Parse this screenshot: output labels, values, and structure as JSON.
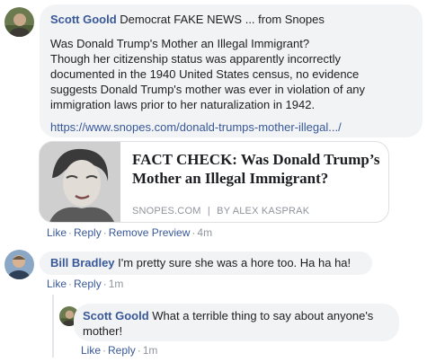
{
  "comment1": {
    "author": "Scott Goold",
    "intro": " Democrat FAKE NEWS ... from Snopes",
    "lines": [
      "Was Donald Trump's Mother an Illegal Immigrant?",
      "Though her citizenship status was apparently incorrectly",
      "documented in the 1940 United States census, no evidence",
      "suggests Donald Trump's mother was ever in violation of any",
      "immigration laws prior to her naturalization in 1942."
    ],
    "link": "https://www.snopes.com/donald-trumps-mother-illegal.../",
    "preview": {
      "headline": "FACT CHECK: Was Donald Trump’s Mother an Illegal Immigrant?",
      "source": "SNOPES.COM",
      "separator": "|",
      "byline": "BY ALEX KASPRAK"
    },
    "actions": {
      "like": "Like",
      "reply": "Reply",
      "remove_preview": "Remove Preview",
      "time": "4m"
    }
  },
  "comment2": {
    "author": "Bill Bradley",
    "text": " I'm pretty sure she was a hore too. Ha ha ha!",
    "actions": {
      "like": "Like",
      "reply": "Reply",
      "time": "1m"
    }
  },
  "reply1": {
    "author": "Scott Goold",
    "text_line1": " What a terrible thing to say about anyone's",
    "text_line2": "mother!",
    "actions": {
      "like": "Like",
      "reply": "Reply",
      "time": "1m"
    }
  },
  "separator_dot": "·"
}
